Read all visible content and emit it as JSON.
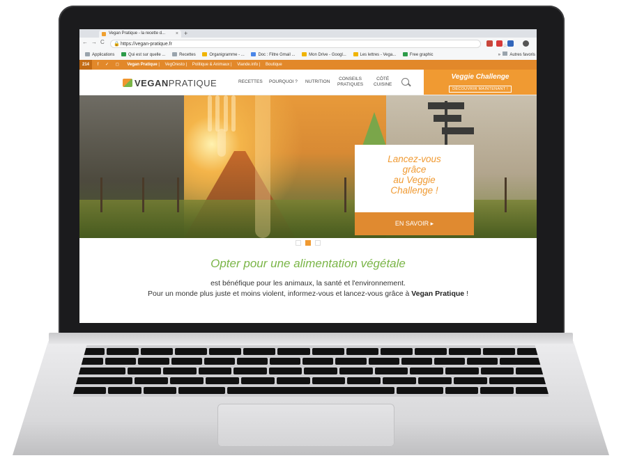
{
  "browser": {
    "tab_title": "Vegan Pratique - la recette d...",
    "url": "https://vegan-pratique.fr",
    "bookmarks": [
      "Applications",
      "Qui est sur quelle ...",
      "Recettes",
      "Organigramme - ...",
      "Doc : Filtre Gmail ...",
      "Mon Drive - Googl...",
      "Les lettres - Vega...",
      "Free graphic"
    ],
    "bookmarks_more": "»",
    "bookmarks_right": "Autres favoris"
  },
  "topstrip": {
    "count": "214",
    "social": "f  ✓  ◻",
    "links": [
      "Vegan Pratique",
      "VegOresto",
      "Politique & Animaux",
      "Viande.info",
      "Boutique"
    ]
  },
  "site": {
    "logo_bold": "VEGAN",
    "logo_rest": "PRATIQUE",
    "menu": [
      "RECETTES",
      "POURQUOI ?",
      "NUTRITION",
      "CONSEILS\nPRATIQUES",
      "CÔTÉ\nCUISINE"
    ],
    "challenge_title": "Veggie Challenge",
    "challenge_cta": "DÉCOUVRIR MAINTENANT !"
  },
  "hero": {
    "promo_text": [
      "Lancez-vous",
      "grâce",
      "au Veggie",
      "Challenge !"
    ],
    "promo_button": "EN SAVOIR ▸",
    "active_slide": 1
  },
  "intro": {
    "heading": "Opter pour une alimentation végétale",
    "line1": "est bénéfique pour les animaux, la santé et l'environnement.",
    "line2_start": "Pour un monde plus juste et moins violent, informez-vous et lancez-vous grâce à ",
    "line2_bold": "Vegan Pratique",
    "line2_end": " !"
  },
  "colors": {
    "accent_orange": "#f09a32",
    "accent_green": "#7ab547"
  }
}
